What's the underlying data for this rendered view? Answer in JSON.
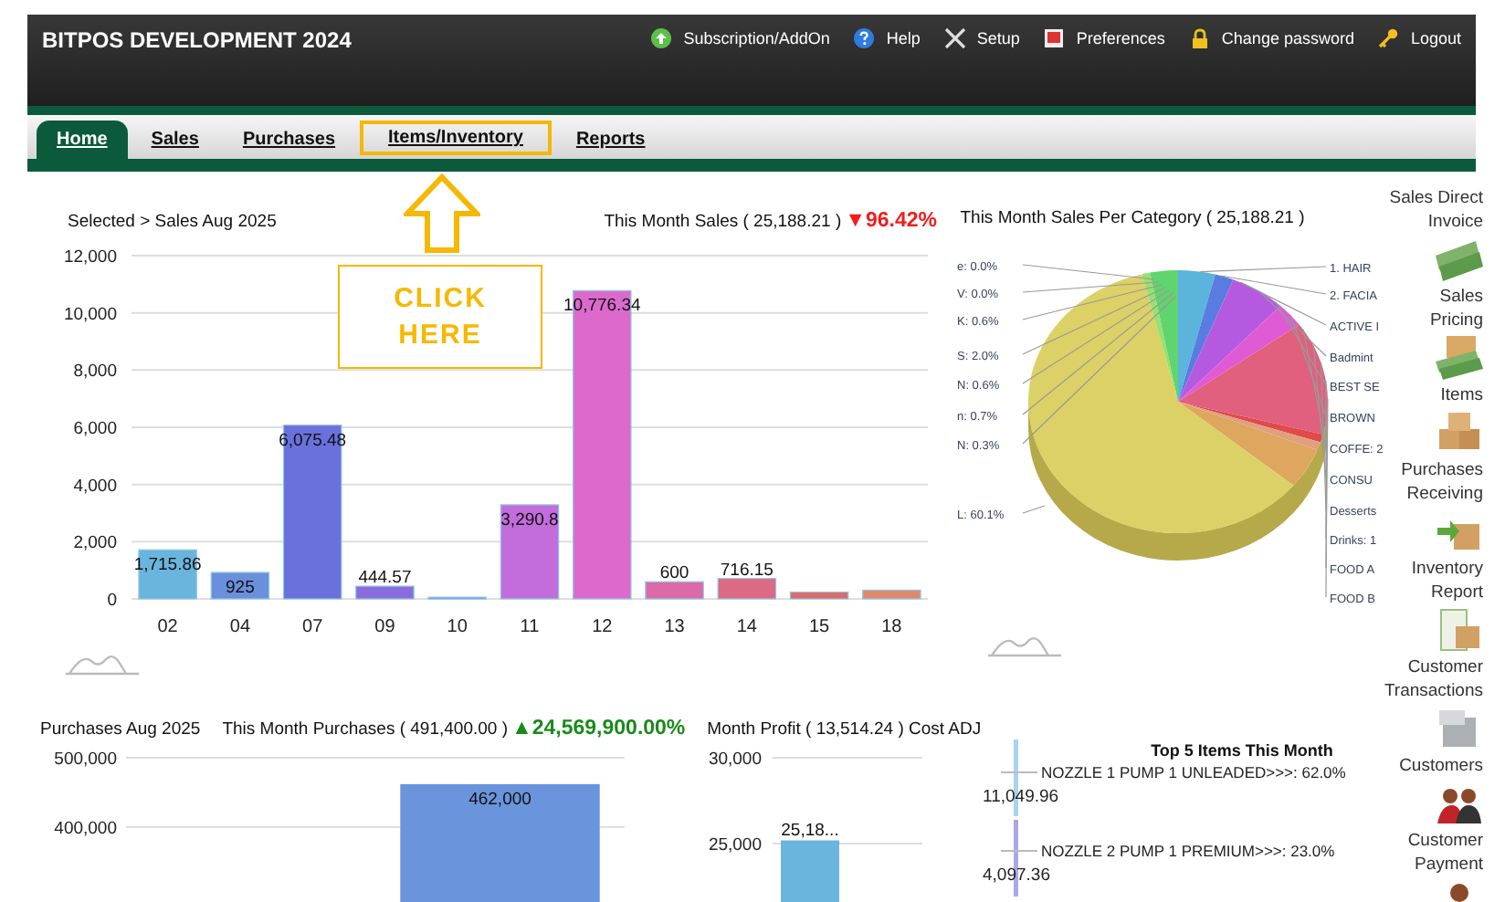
{
  "header": {
    "title": "BITPOS DEVELOPMENT 2024",
    "links": [
      {
        "label": "Subscription/AddOn",
        "kind": "subscription"
      },
      {
        "label": "Help",
        "kind": "help"
      },
      {
        "label": "Setup",
        "kind": "setup"
      },
      {
        "label": "Preferences",
        "kind": "preferences"
      },
      {
        "label": "Change password",
        "kind": "password"
      },
      {
        "label": "Logout",
        "kind": "logout"
      }
    ]
  },
  "tabs": [
    {
      "label": "Home",
      "selected": true,
      "highlighted": false
    },
    {
      "label": "Sales",
      "selected": false,
      "highlighted": false
    },
    {
      "label": "Purchases",
      "selected": false,
      "highlighted": false
    },
    {
      "label": "Items/Inventory",
      "selected": false,
      "highlighted": true
    },
    {
      "label": "Reports",
      "selected": false,
      "highlighted": false
    }
  ],
  "callout": {
    "text": "CLICK\nHERE"
  },
  "sales_chart": {
    "selection": "Selected > Sales Aug 2025",
    "summary": "This Month Sales ( 25,188.21 )",
    "change": {
      "text": "▼96.42%",
      "color": "#f21c1c"
    },
    "chart_data": {
      "type": "bar",
      "grid": true,
      "categories": [
        "02",
        "04",
        "07",
        "09",
        "10",
        "11",
        "12",
        "13",
        "14",
        "15",
        "18"
      ],
      "series": [
        {
          "values": [
            1715.86,
            925,
            6075.48,
            444.57,
            60,
            3290.8,
            10776.34,
            600,
            716.15,
            240,
            305
          ]
        }
      ],
      "ylim": [
        0,
        12000
      ],
      "yticks": [
        {
          "value": 0,
          "label": "0"
        },
        {
          "value": 2000,
          "label": "2,000"
        },
        {
          "value": 4000,
          "label": "4,000"
        },
        {
          "value": 6000,
          "label": "6,000"
        },
        {
          "value": 8000,
          "label": "8,000"
        },
        {
          "value": 10000,
          "label": "10,000"
        },
        {
          "value": 12000,
          "label": "12,000"
        }
      ],
      "value_labels": [
        "1,715.86",
        "925",
        "6,075.48",
        "444.57",
        null,
        "3,290.8",
        "10,776.34",
        "600",
        "716.15",
        null,
        null
      ]
    }
  },
  "category_pie": {
    "title": "This Month Sales Per Category ( 25,188.21 )",
    "left_labels": [
      "e: 0.0%",
      "V: 0.0%",
      "K: 0.6%",
      "S: 2.0%",
      "N: 0.6%",
      "n: 0.7%",
      "N: 0.3%",
      "L: 60.1%"
    ],
    "right_labels": [
      "1. HAIR",
      "2. FACIA",
      "ACTIVE I",
      "Badmint",
      "BEST SE",
      "BROWN",
      "COFFE: 2",
      "CONSU",
      "Desserts",
      "Drinks: 1",
      "FOOD A",
      "FOOD B"
    ]
  },
  "purchases_chart": {
    "title": "Purchases Aug 2025",
    "summary": "This Month Purchases ( 491,400.00 )",
    "change": {
      "text": "▲24,569,900.00%",
      "color": "#1a8a1a"
    },
    "chart_data": {
      "type": "bar",
      "grid": true,
      "series": [
        {
          "color": "#6a95dc",
          "values": [
            null,
            462000
          ]
        }
      ],
      "ylim": [
        292000,
        500000
      ],
      "yticks": [
        {
          "value": 400000,
          "label": "400,000"
        },
        {
          "value": 500000,
          "label": "500,000"
        }
      ],
      "value_labels": [
        null,
        "462,000"
      ]
    }
  },
  "profit_chart": {
    "title": "Month Profit ( 13,514.24 ) Cost ADJ",
    "chart_data": {
      "type": "bar",
      "grid": true,
      "series": [
        {
          "color": "#6ab5dd",
          "values": [
            25188.21,
            null
          ]
        }
      ],
      "ylim": [
        21600,
        30000
      ],
      "yticks": [
        {
          "value": 25000,
          "label": "25,000"
        },
        {
          "value": 30000,
          "label": "30,000"
        }
      ],
      "value_labels": [
        "25,18...",
        null
      ]
    }
  },
  "top_items": {
    "title": "Top 5 Items This Month",
    "items": [
      {
        "label": "NOZZLE 1 PUMP 1 UNLEADED>>>: 62.0%",
        "value": "11,049.96",
        "color": "#a9d3ee"
      },
      {
        "label": "NOZZLE 2 PUMP 1 PREMIUM>>>: 23.0%",
        "value": "4,097.36",
        "color": "#a8a8ea"
      }
    ]
  },
  "shortcuts": [
    {
      "label": "Sales Direct\nInvoice",
      "kind": "money"
    },
    {
      "label": "Sales\nPricing",
      "kind": "boxes-money"
    },
    {
      "label": "Items",
      "kind": "boxes"
    },
    {
      "label": "Purchases\nReceiving",
      "kind": "box-arrow"
    },
    {
      "label": "Inventory\nReport",
      "kind": "report"
    },
    {
      "label": "Customer\nTransactions",
      "kind": "register"
    },
    {
      "label": "Customers",
      "kind": "people"
    },
    {
      "label": "Customer\nPayment",
      "kind": "person"
    }
  ]
}
